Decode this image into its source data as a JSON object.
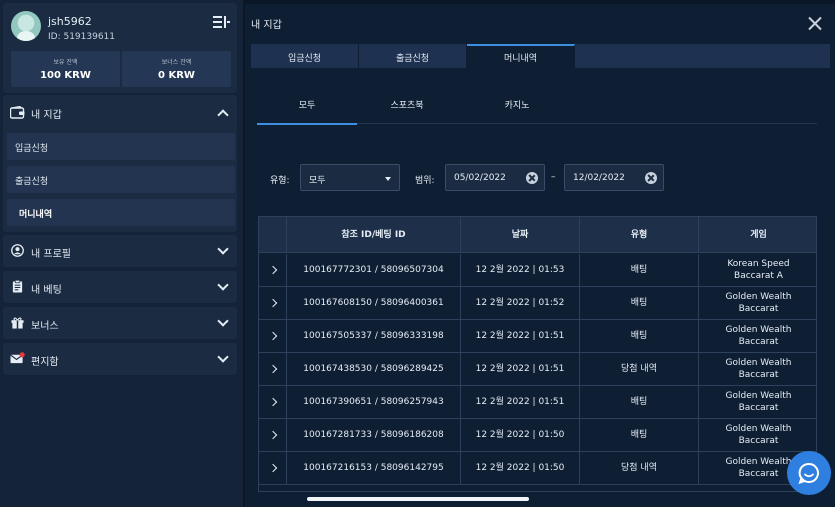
{
  "user": {
    "name": "jsh5962",
    "id_text": "ID: 519139611"
  },
  "balances": [
    {
      "label": "보유 잔액",
      "value": "100 KRW"
    },
    {
      "label": "보너스 잔액",
      "value": "0 KRW"
    }
  ],
  "sidebar": {
    "wallet": {
      "title": "내 지갑",
      "items": [
        "입금신청",
        "출금신청",
        "머니내역"
      ],
      "active": "머니내역"
    },
    "menus": [
      "내 프로필",
      "내 베팅",
      "보너스",
      "편지함"
    ]
  },
  "main": {
    "title": "내 지갑",
    "tabs": [
      "입금신청",
      "출금신청",
      "머니내역"
    ],
    "active_tab": "머니내역",
    "subtabs": [
      "모두",
      "스포츠북",
      "카지노"
    ],
    "active_subtab": "모두",
    "filters": {
      "type_label": "유형:",
      "type_value": "모두",
      "range_label": "범위:",
      "from_date": "05/02/2022",
      "separator": "–",
      "to_date": "12/02/2022"
    },
    "table": {
      "headers": [
        "참조 ID/베팅 ID",
        "날짜",
        "유형",
        "게임"
      ],
      "rows": [
        {
          "ref": "100167772301 / 58096507304",
          "date": "12 2월 2022 | 01:53",
          "type": "배팅",
          "game": [
            "Korean Speed",
            "Baccarat A"
          ]
        },
        {
          "ref": "100167608150 / 58096400361",
          "date": "12 2월 2022 | 01:52",
          "type": "배팅",
          "game": [
            "Golden Wealth",
            "Baccarat"
          ]
        },
        {
          "ref": "100167505337 / 58096333198",
          "date": "12 2월 2022 | 01:51",
          "type": "배팅",
          "game": [
            "Golden Wealth",
            "Baccarat"
          ]
        },
        {
          "ref": "100167438530 / 58096289425",
          "date": "12 2월 2022 | 01:51",
          "type": "당첨 내역",
          "game": [
            "Golden Wealth",
            "Baccarat"
          ]
        },
        {
          "ref": "100167390651 / 58096257943",
          "date": "12 2월 2022 | 01:51",
          "type": "배팅",
          "game": [
            "Golden Wealth",
            "Baccarat"
          ]
        },
        {
          "ref": "100167281733 / 58096186208",
          "date": "12 2월 2022 | 01:50",
          "type": "배팅",
          "game": [
            "Golden Wealth",
            "Baccarat"
          ]
        },
        {
          "ref": "100167216153 / 58096142795",
          "date": "12 2월 2022 | 01:50",
          "type": "당첨 내역",
          "game": [
            "Golden Wealth",
            "Baccarat"
          ]
        }
      ]
    }
  },
  "colors": {
    "accent": "#3d8fe0",
    "background": "#0f1f33",
    "sidebar": "#142338",
    "chat_button": "#2f7fe0"
  },
  "icons": [
    "avatar",
    "menu-toggle-icon",
    "wallet-icon",
    "profile-icon",
    "betting-clipboard-icon",
    "gift-icon",
    "mail-icon",
    "close-icon",
    "chevron-down-icon",
    "chevron-right-icon",
    "chat-icon"
  ]
}
